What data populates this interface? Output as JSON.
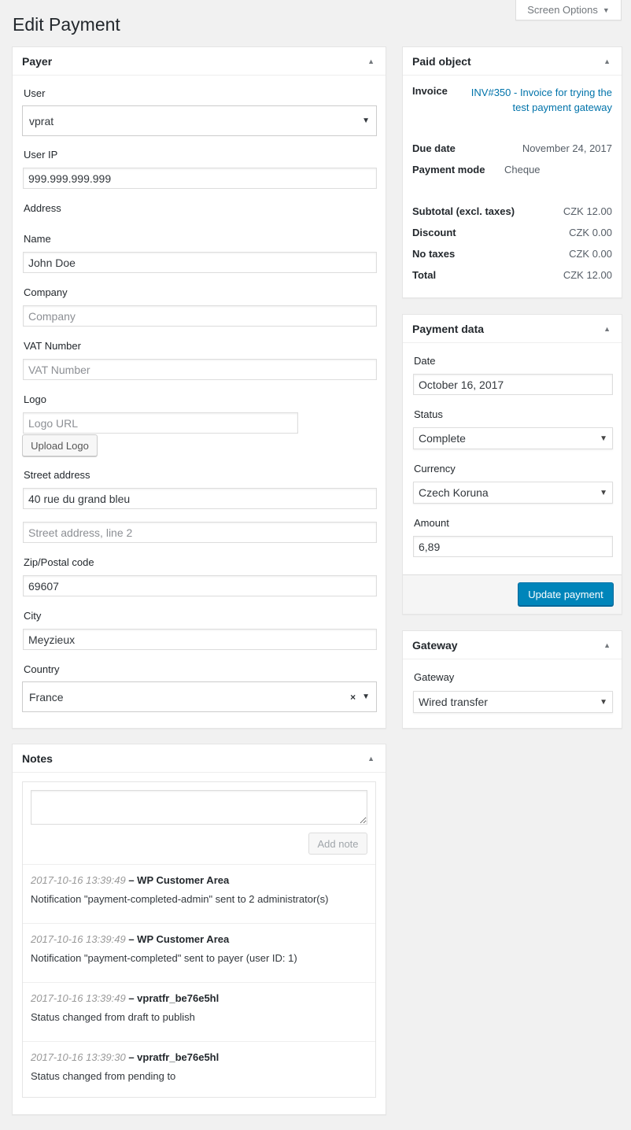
{
  "header": {
    "screen_options": "Screen Options",
    "title": "Edit Payment"
  },
  "payer": {
    "title": "Payer",
    "user_label": "User",
    "user_value": "vprat",
    "ip_label": "User IP",
    "ip_value": "999.999.999.999",
    "address_label": "Address",
    "name_label": "Name",
    "name_value": "John Doe",
    "company_label": "Company",
    "company_placeholder": "Company",
    "vat_label": "VAT Number",
    "vat_placeholder": "VAT Number",
    "logo_label": "Logo",
    "logo_placeholder": "Logo URL",
    "upload_logo": "Upload Logo",
    "street_label": "Street address",
    "street_value": "40 rue du grand bleu",
    "street2_placeholder": "Street address, line 2",
    "zip_label": "Zip/Postal code",
    "zip_value": "69607",
    "city_label": "City",
    "city_value": "Meyzieux",
    "country_label": "Country",
    "country_value": "France"
  },
  "paid_object": {
    "title": "Paid object",
    "invoice_label": "Invoice",
    "invoice_link": "INV#350 - Invoice for trying the test payment gateway",
    "due_date_label": "Due date",
    "due_date_value": "November 24, 2017",
    "payment_mode_label": "Payment mode",
    "payment_mode_value": "Cheque",
    "totals": [
      {
        "label": "Subtotal (excl. taxes)",
        "value": "CZK 12.00"
      },
      {
        "label": "Discount",
        "value": "CZK 0.00"
      },
      {
        "label": "No taxes",
        "value": "CZK 0.00"
      },
      {
        "label": "Total",
        "value": "CZK 12.00"
      }
    ]
  },
  "payment_data": {
    "title": "Payment data",
    "date_label": "Date",
    "date_value": "October 16, 2017",
    "status_label": "Status",
    "status_value": "Complete",
    "currency_label": "Currency",
    "currency_value": "Czech Koruna",
    "amount_label": "Amount",
    "amount_value": "6,89",
    "update_button": "Update payment"
  },
  "gateway": {
    "title": "Gateway",
    "gateway_label": "Gateway",
    "gateway_value": "Wired transfer"
  },
  "notes": {
    "title": "Notes",
    "add_note": "Add note",
    "items": [
      {
        "timestamp": "2017-10-16 13:39:49",
        "author": "– WP Customer Area",
        "text": "Notification \"payment-completed-admin\" sent to 2 administrator(s)"
      },
      {
        "timestamp": "2017-10-16 13:39:49",
        "author": "– WP Customer Area",
        "text": "Notification \"payment-completed\" sent to payer (user ID: 1)"
      },
      {
        "timestamp": "2017-10-16 13:39:49",
        "author": "– vpratfr_be76e5hl",
        "text": "Status changed from draft to publish"
      },
      {
        "timestamp": "2017-10-16 13:39:30",
        "author": "– vpratfr_be76e5hl",
        "text": "Status changed from pending to"
      }
    ]
  },
  "colors": {
    "primary": "#0085ba",
    "link": "#0073aa",
    "background": "#f1f1f1"
  }
}
